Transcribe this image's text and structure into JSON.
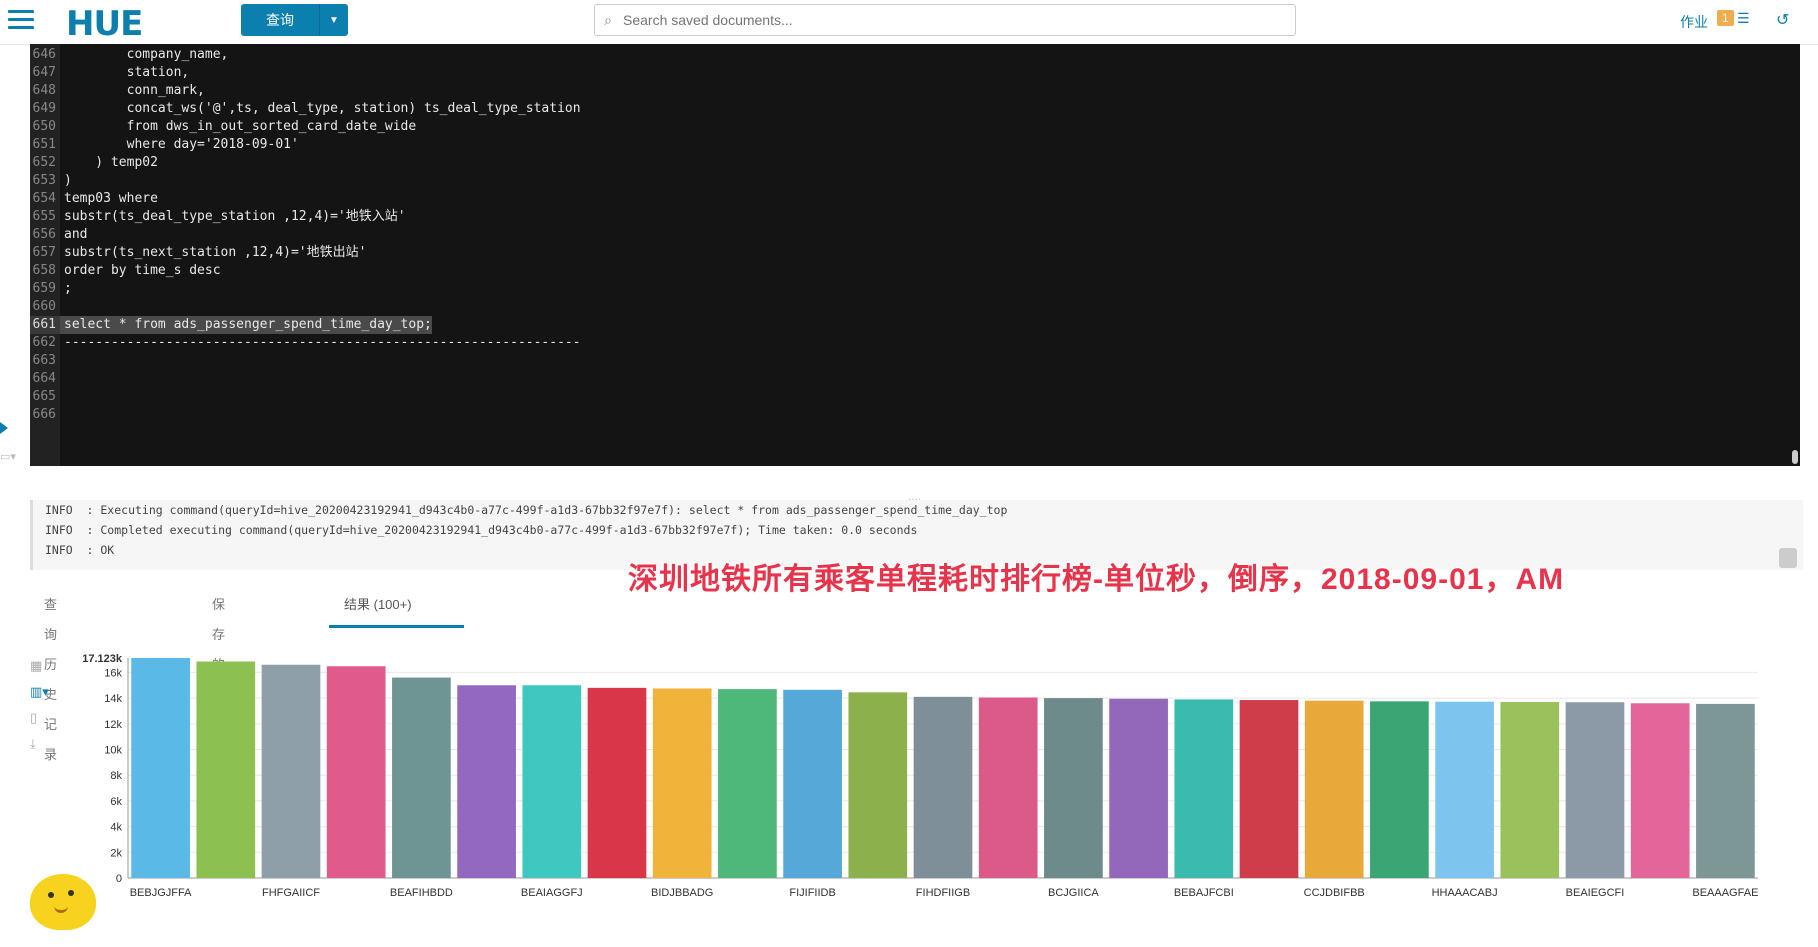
{
  "app": {
    "logo": "HUE",
    "query_button": "查询",
    "search_placeholder": "Search saved documents...",
    "jobs_label": "作业",
    "jobs_count": "1"
  },
  "editor": {
    "lines": [
      {
        "n": "646",
        "t": "        company_name,"
      },
      {
        "n": "647",
        "t": "        station,"
      },
      {
        "n": "648",
        "t": "        conn_mark,"
      },
      {
        "n": "649",
        "t": "        concat_ws('@',ts, deal_type, station) ts_deal_type_station"
      },
      {
        "n": "650",
        "t": "        from dws_in_out_sorted_card_date_wide"
      },
      {
        "n": "651",
        "t": "        where day='2018-09-01'"
      },
      {
        "n": "652",
        "t": "    ) temp02"
      },
      {
        "n": "653",
        "t": ")"
      },
      {
        "n": "654",
        "t": "temp03 where"
      },
      {
        "n": "655",
        "t": "substr(ts_deal_type_station ,12,4)='地铁入站'"
      },
      {
        "n": "656",
        "t": "and"
      },
      {
        "n": "657",
        "t": "substr(ts_next_station ,12,4)='地铁出站'"
      },
      {
        "n": "658",
        "t": "order by time_s desc"
      },
      {
        "n": "659",
        "t": ";"
      },
      {
        "n": "660",
        "t": ""
      },
      {
        "n": "661",
        "t": "select * from ads_passenger_spend_time_day_top;"
      },
      {
        "n": "662",
        "t": "------------------------------------------------------------------"
      },
      {
        "n": "663",
        "t": ""
      },
      {
        "n": "664",
        "t": ""
      },
      {
        "n": "665",
        "t": ""
      },
      {
        "n": "666",
        "t": ""
      }
    ]
  },
  "log": [
    "INFO  : Executing command(queryId=hive_20200423192941_d943c4b0-a77c-499f-a1d3-67bb32f97e7f): select * from ads_passenger_spend_time_day_top",
    "INFO  : Completed executing command(queryId=hive_20200423192941_d943c4b0-a77c-499f-a1d3-67bb32f97e7f); Time taken: 0.0 seconds",
    "INFO  : OK"
  ],
  "overlay_title": "深圳地铁所有乘客单程耗时排行榜-单位秒，倒序，2018-09-01，AM",
  "tabs": [
    "查询历史记录",
    "保存的查询",
    "结果 (100+)"
  ],
  "chart_data": {
    "type": "bar",
    "ymax_label": "17.123k",
    "ylim": [
      0,
      17123
    ],
    "yticks": [
      "0",
      "2k",
      "4k",
      "6k",
      "8k",
      "10k",
      "12k",
      "14k",
      "16k"
    ],
    "categories": [
      "BEBJGJFFA",
      "",
      "FHFGAIICF",
      "",
      "BEAFIHBDD",
      "",
      "BEAIAGGFJ",
      "",
      "BIDJBBADG",
      "",
      "FIJIFIIDB",
      "",
      "FIHDFIIGB",
      "",
      "BCJGIICA",
      "",
      "BEBAJFCBI",
      "",
      "CCJDBIFBB",
      "",
      "HHAAACABJ",
      "",
      "BEAIEGCFI",
      "",
      "BEAAAGFAE"
    ],
    "values": [
      17123,
      16850,
      16600,
      16480,
      15600,
      15000,
      15000,
      14800,
      14750,
      14700,
      14650,
      14450,
      14100,
      14050,
      14000,
      13950,
      13900,
      13850,
      13800,
      13750,
      13720,
      13700,
      13680,
      13600,
      13550
    ],
    "colors": [
      "#5ab9e6",
      "#8cc152",
      "#8e9fa9",
      "#e05b8c",
      "#6e9594",
      "#9368c0",
      "#3fc8c0",
      "#d9364a",
      "#f0b43a",
      "#4db87a",
      "#56a8d8",
      "#8cb14c",
      "#7e8f99",
      "#dc5a8a",
      "#6c8b8a",
      "#9368bb",
      "#3bbab0",
      "#cf3d4a",
      "#e8a93a",
      "#3aa673",
      "#7dc4ee",
      "#9bc15c",
      "#8c9aa7",
      "#e3669a",
      "#7d9797"
    ]
  }
}
